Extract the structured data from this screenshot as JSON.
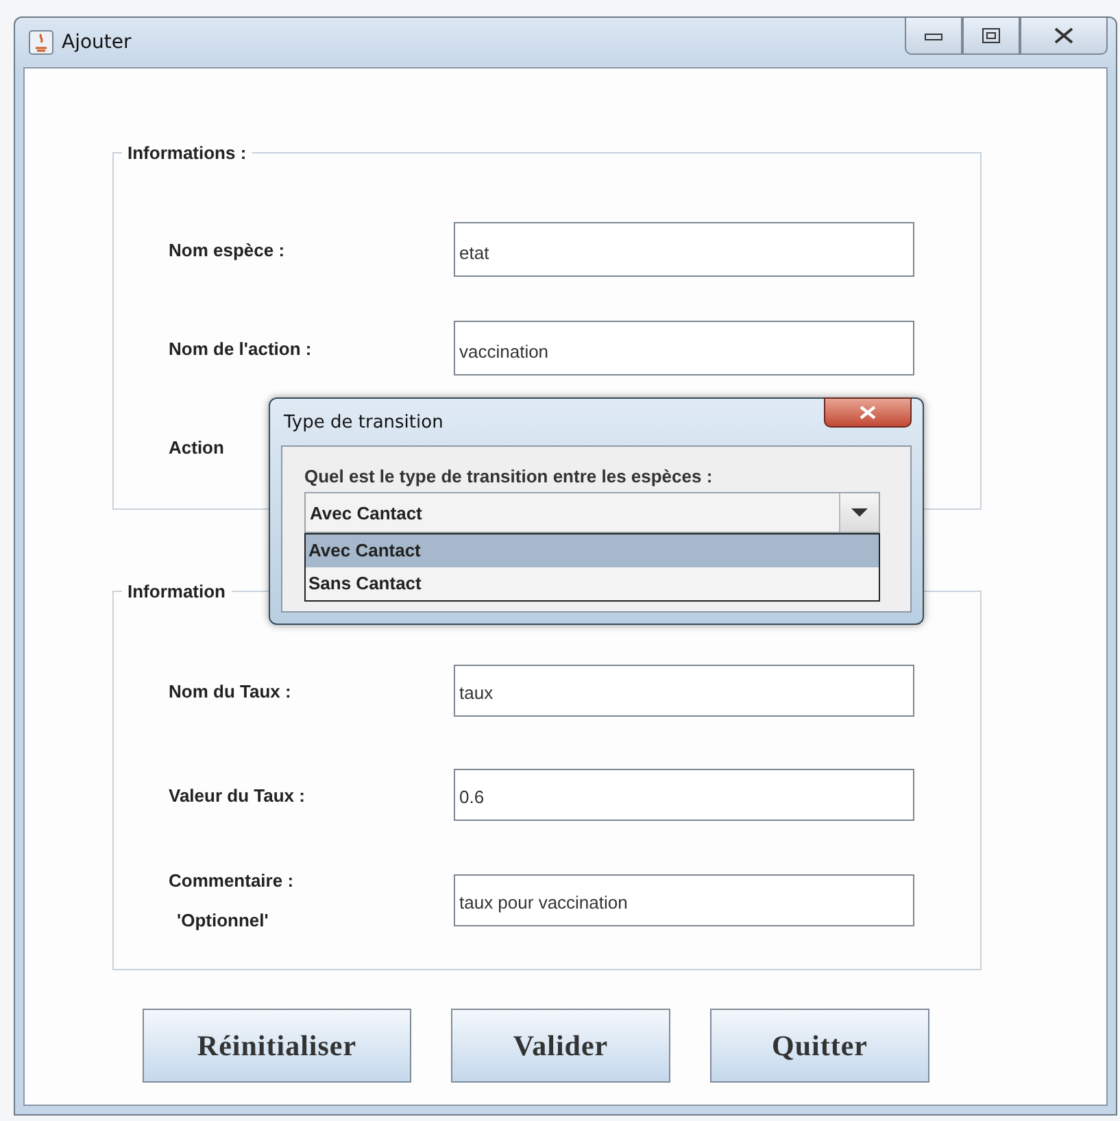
{
  "window": {
    "title": "Ajouter"
  },
  "panels": [
    {
      "title": "Informations :",
      "rows": [
        {
          "label": "Nom espèce :",
          "value": "etat"
        },
        {
          "label": "Nom de l'action :",
          "value": "vaccination"
        },
        {
          "label": "Action"
        }
      ]
    },
    {
      "title": "Information",
      "rows": [
        {
          "label": "Nom du Taux :",
          "value": "taux"
        },
        {
          "label": "Valeur du Taux :",
          "value": "0.6"
        },
        {
          "label": "Commentaire :",
          "note": "'Optionnel'",
          "value": "taux pour vaccination"
        }
      ]
    }
  ],
  "buttons": [
    "Réinitialiser",
    "Valider",
    "Quitter"
  ],
  "dialog": {
    "title": "Type de transition",
    "prompt": "Quel est le type de transition entre les espèces :",
    "combo": {
      "value": "Avec Cantact",
      "options": [
        {
          "label": "Avec Cantact",
          "selected": true
        },
        {
          "label": "Sans Cantact",
          "selected": false
        }
      ]
    }
  }
}
